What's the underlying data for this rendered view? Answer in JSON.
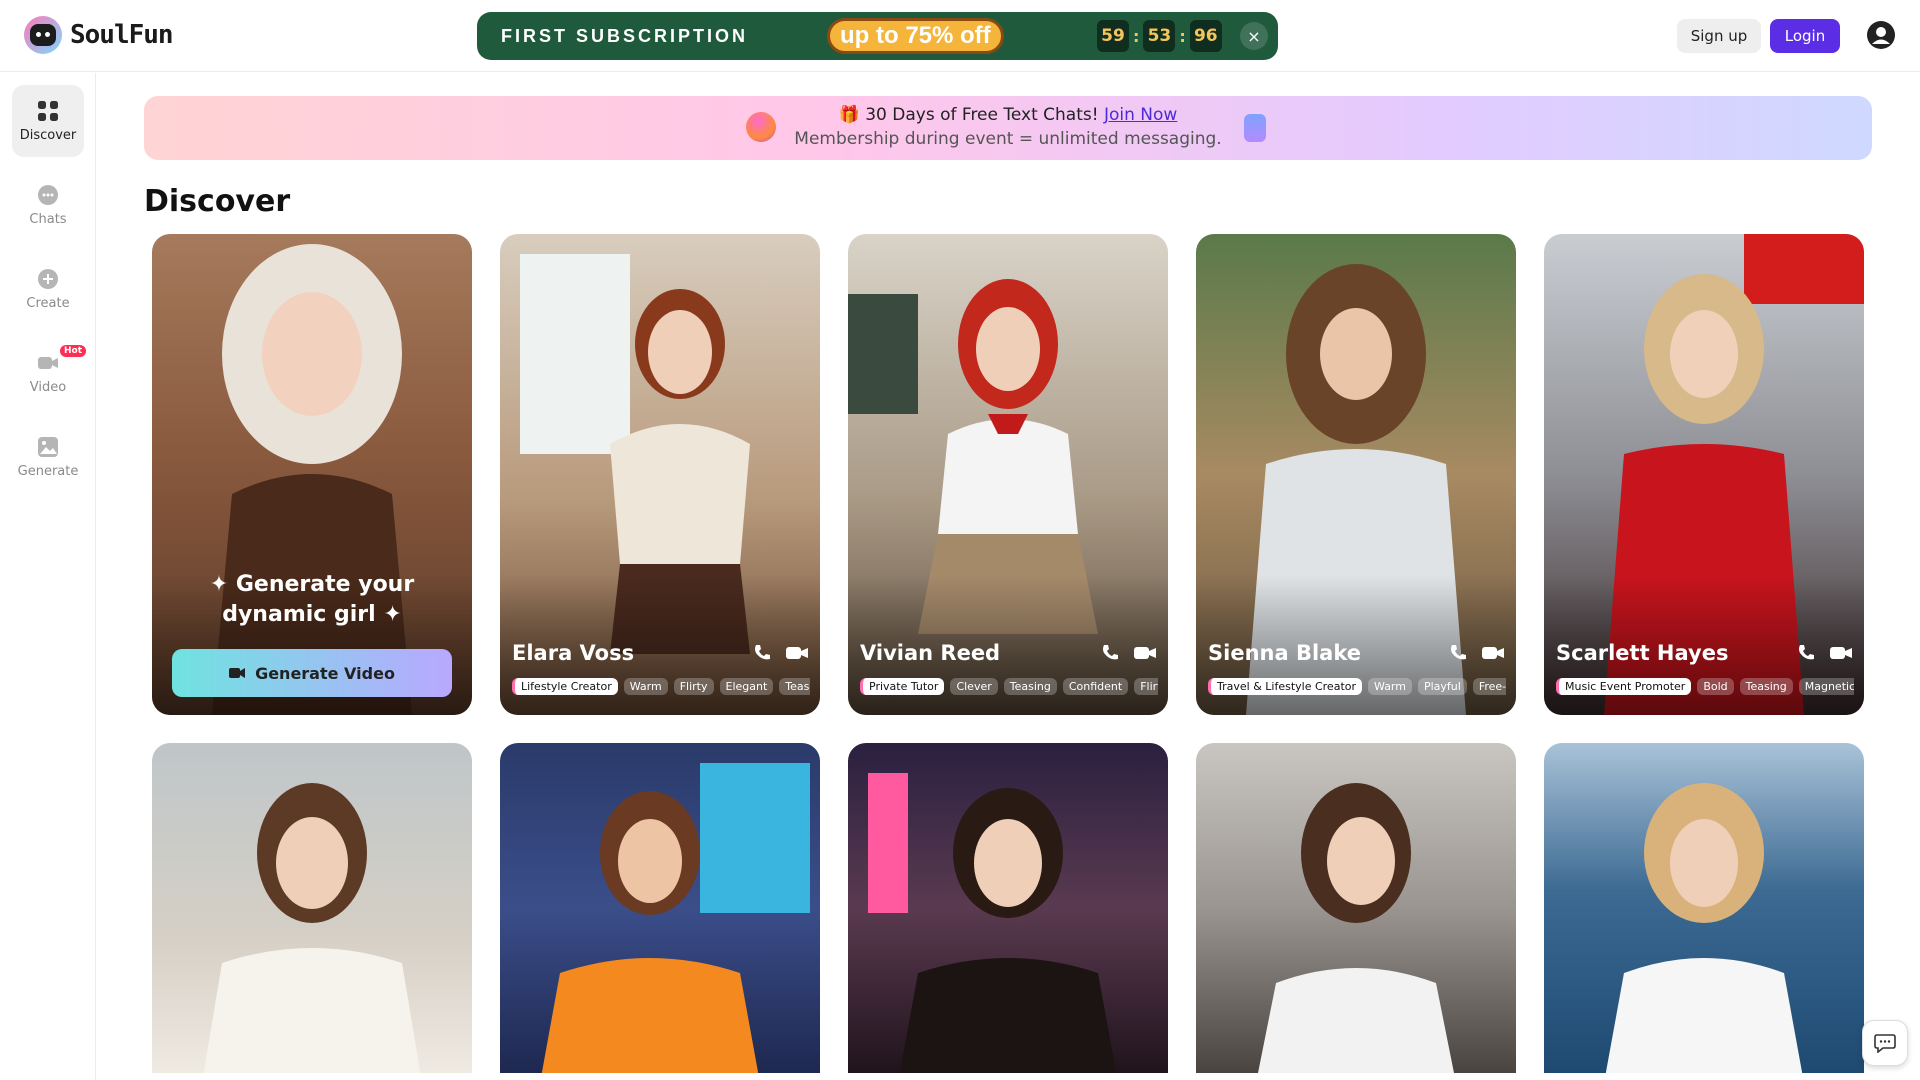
{
  "header": {
    "logo_text": "SoulFun",
    "promo": {
      "title": "FIRST SUBSCRIPTION",
      "offer_prefix": "up to",
      "offer_value": "75% off",
      "countdown": [
        "59",
        "53",
        "96"
      ],
      "close": "×"
    },
    "signup_label": "Sign up",
    "login_label": "Login"
  },
  "sidebar": {
    "items": [
      {
        "label": "Discover",
        "icon": "grid-icon"
      },
      {
        "label": "Chats",
        "icon": "chat-icon"
      },
      {
        "label": "Create",
        "icon": "plus-circle-icon"
      },
      {
        "label": "Video",
        "icon": "video-camera-icon",
        "badge": "Hot"
      },
      {
        "label": "Generate",
        "icon": "image-icon"
      }
    ]
  },
  "banner": {
    "line1_prefix": "🎁 30 Days of Free Text Chats!",
    "link": "Join Now",
    "line2": "Membership during event = unlimited messaging."
  },
  "page_title": "Discover",
  "generate_card": {
    "text_line1": "✦ Generate your",
    "text_line2": "dynamic girl ✦",
    "button": "Generate Video"
  },
  "cards": [
    {
      "name": "Elara Voss",
      "tags": [
        "Lifestyle Creator",
        "Warm",
        "Flirty",
        "Elegant",
        "Teasin"
      ]
    },
    {
      "name": "Vivian Reed",
      "tags": [
        "Private Tutor",
        "Clever",
        "Teasing",
        "Confident",
        "Flirty"
      ]
    },
    {
      "name": "Sienna Blake",
      "tags": [
        "Travel & Lifestyle Creator",
        "Warm",
        "Playful",
        "Free-S"
      ]
    },
    {
      "name": "Scarlett Hayes",
      "tags": [
        "Music Event Promoter",
        "Bold",
        "Teasing",
        "Magnetic"
      ]
    }
  ],
  "colors": {
    "accent": "#5b2ee6",
    "promo_bg": "#1f5a3c",
    "promo_offer": "#f5b43a",
    "countdown_text": "#f5c45a",
    "hot_badge": "#ff2d55"
  }
}
